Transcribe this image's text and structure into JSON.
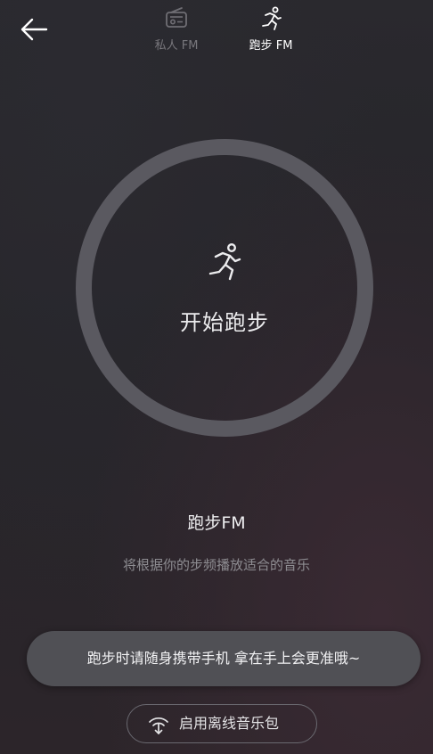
{
  "header": {
    "back_icon": "arrow-left-icon",
    "tabs": [
      {
        "label": "私人 FM",
        "icon": "radio-icon",
        "active": false
      },
      {
        "label": "跑步 FM",
        "icon": "running-icon",
        "active": true
      }
    ]
  },
  "main": {
    "start_button": {
      "label": "开始跑步",
      "icon": "running-icon"
    },
    "title": "跑步FM",
    "description": "将根据你的步频播放适合的音乐"
  },
  "toast": {
    "message": "跑步时请随身携带手机 拿在手上会更准哦~"
  },
  "offline": {
    "label": "启用离线音乐包",
    "icon": "offline-download-icon"
  },
  "colors": {
    "background": "#26252a",
    "ring": "#5a5960",
    "toast_bg": "#505055",
    "inactive_text": "#78777c",
    "active_text": "#ffffff"
  }
}
